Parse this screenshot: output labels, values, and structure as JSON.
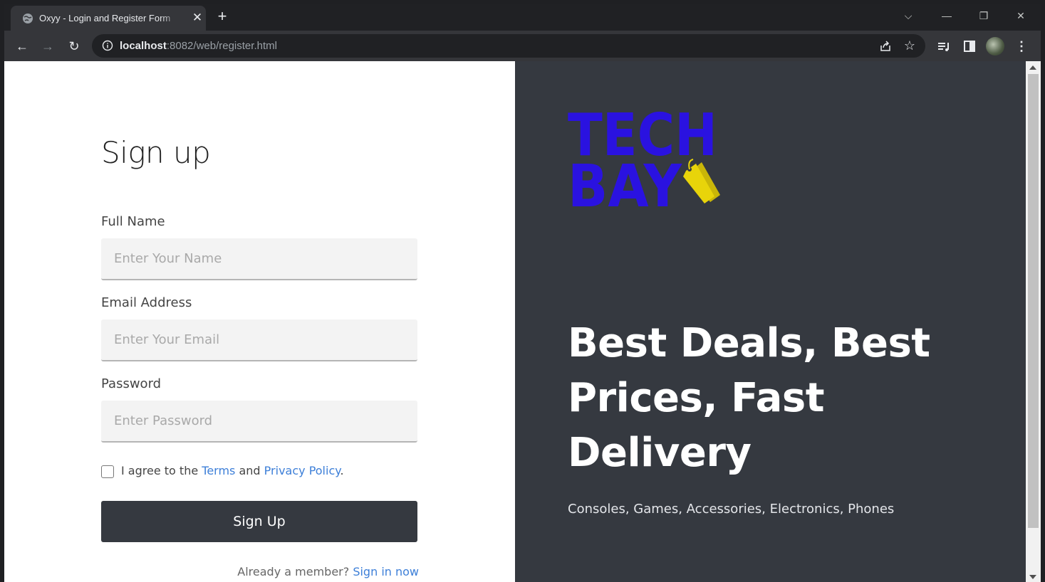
{
  "browser": {
    "tab_title": "Oxyy - Login and Register Form",
    "url_host": "localhost",
    "url_rest": ":8082/web/register.html"
  },
  "form": {
    "heading": "Sign up",
    "name_label": "Full Name",
    "name_placeholder": "Enter Your Name",
    "email_label": "Email Address",
    "email_placeholder": "Enter Your Email",
    "password_label": "Password",
    "password_placeholder": "Enter Password",
    "agree_prefix": "I agree to the ",
    "terms_link": "Terms",
    "agree_and": " and ",
    "privacy_link": "Privacy Policy",
    "agree_suffix": ".",
    "submit_label": "Sign Up",
    "member_text": "Already a member? ",
    "signin_link": "Sign in now"
  },
  "hero": {
    "logo_line1": "TECH",
    "logo_line2": "BAY",
    "headline": "Best Deals, Best Prices, Fast Delivery",
    "tagline": "Consoles, Games, Accessories, Electronics, Phones"
  },
  "colors": {
    "panel_dark": "#353940",
    "link": "#3d7fd8",
    "logo_blue": "#2a12e0",
    "logo_tag": "#e8d40a"
  }
}
